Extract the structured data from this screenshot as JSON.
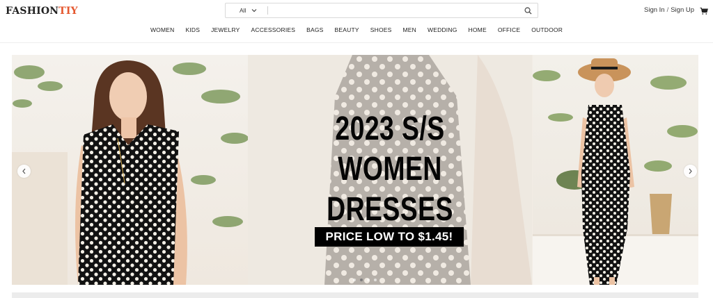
{
  "logo": {
    "part1": "FASHION",
    "part2": "TIY"
  },
  "search": {
    "category": "All",
    "placeholder": ""
  },
  "account": {
    "sign_in": "Sign In",
    "separator": "/",
    "sign_up": "Sign Up"
  },
  "nav": [
    "WOMEN",
    "KIDS",
    "JEWELRY",
    "ACCESSORIES",
    "BAGS",
    "BEAUTY",
    "SHOES",
    "MEN",
    "WEDDING",
    "HOME",
    "OFFICE",
    "OUTDOOR"
  ],
  "banner": {
    "headline_line1": "2023 S/S",
    "headline_line2": "WOMEN DRESSES",
    "price": "PRICE LOW TO $1.45!"
  },
  "colors": {
    "brand_accent": "#e4572e",
    "dress": "#0f0f0f",
    "dots": "#f3efe6"
  },
  "icons": [
    "chevron-down-icon",
    "search-icon",
    "cart-icon",
    "chevron-left-icon",
    "chevron-right-icon"
  ]
}
